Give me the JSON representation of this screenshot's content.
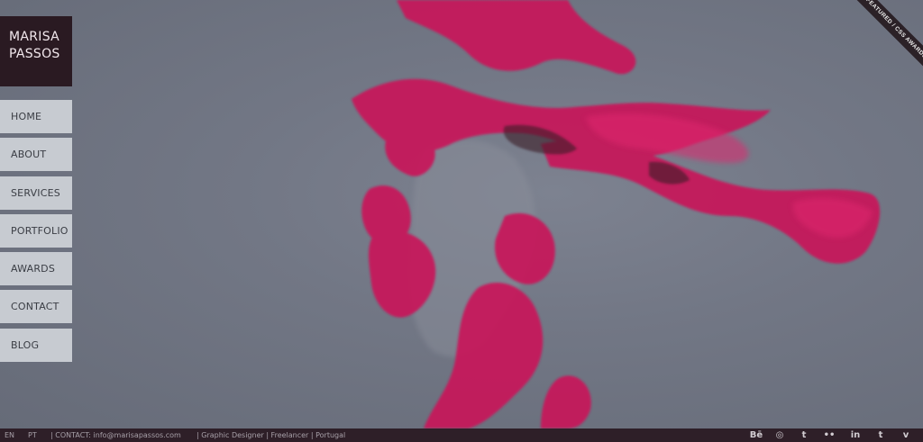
{
  "brand": {
    "line1": "MARISA",
    "line2": "PASSOS"
  },
  "nav": {
    "items": [
      {
        "label": "HOME"
      },
      {
        "label": "ABOUT"
      },
      {
        "label": "SERVICES"
      },
      {
        "label": "PORTFOLIO"
      },
      {
        "label": "AWARDS"
      },
      {
        "label": "CONTACT"
      },
      {
        "label": "BLOG"
      }
    ]
  },
  "ribbon": {
    "text": "FEATURED / CSS AWARDS"
  },
  "footer": {
    "lang_en": "EN",
    "lang_pt": "PT",
    "contact": "| CONTACT: info@marisapassos.com",
    "tagline": "| Graphic Designer | Freelancer | Portugal"
  },
  "socials": [
    {
      "icon": "behance-icon",
      "glyph": "Bē"
    },
    {
      "icon": "dribbble-icon",
      "glyph": "◎"
    },
    {
      "icon": "tumblr-icon",
      "glyph": "t"
    },
    {
      "icon": "flickr-icon",
      "glyph": "••"
    },
    {
      "icon": "linkedin-icon",
      "glyph": "in"
    },
    {
      "icon": "twitter-icon",
      "glyph": "t"
    },
    {
      "icon": "vimeo-icon",
      "glyph": "v"
    }
  ],
  "colors": {
    "background": "#6f7480",
    "accent_pink": "#c8175a",
    "dark": "#2a1a22",
    "nav_bg": "#c7cbd1"
  }
}
